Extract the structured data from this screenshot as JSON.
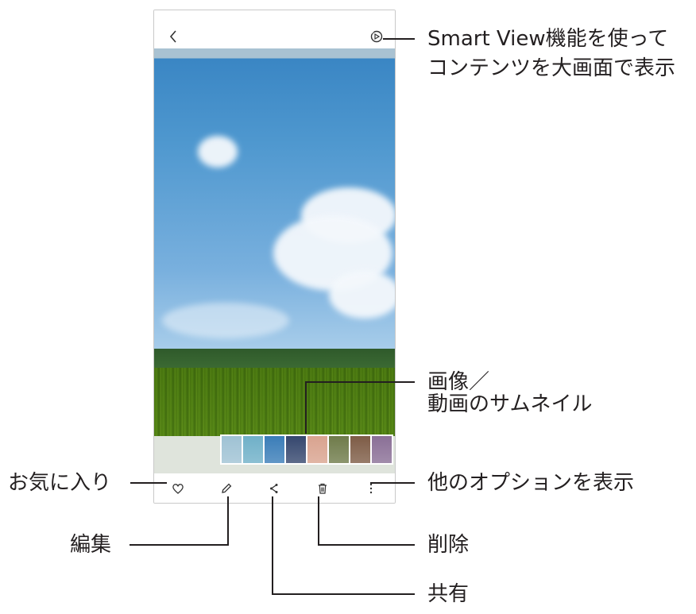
{
  "labels": {
    "smart_view_line1": "Smart View機能を使って",
    "smart_view_line2": "コンテンツを大画面で表示",
    "thumbnails_line1": "画像／",
    "thumbnails_line2": "動画のサムネイル",
    "favorite": "お気に入り",
    "more_options": "他のオプションを表示",
    "edit": "編集",
    "delete": "削除",
    "share": "共有"
  },
  "icons": {
    "back": "chevron-left-icon",
    "smart_view": "smart-view-icon",
    "favorite": "heart-icon",
    "edit": "pencil-icon",
    "share": "share-icon",
    "delete": "trash-icon",
    "more": "more-vertical-icon"
  },
  "thumbnail_colors": [
    "#9fc2d4",
    "#6fb0c8",
    "#3a7db8",
    "#35476e",
    "#d9a38f",
    "#6f7b4a",
    "#7e5c46",
    "#8a6f96"
  ],
  "colors": {
    "text": "#231f20",
    "frame": "#c9c9c9"
  }
}
